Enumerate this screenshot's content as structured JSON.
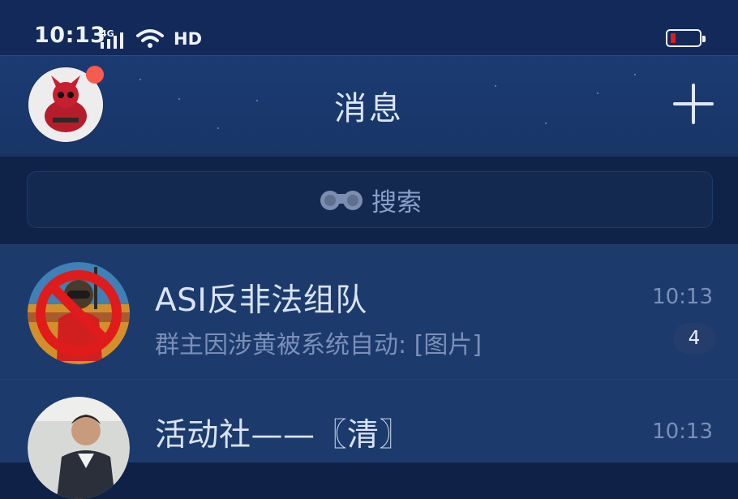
{
  "status": {
    "time": "10:13",
    "network": "4G",
    "hd": "HD"
  },
  "header": {
    "title": "消息"
  },
  "search": {
    "placeholder": "搜索"
  },
  "conversations": [
    {
      "name": "ASI反非法组队",
      "preview": "群主因涉黄被系统自动: [图片]",
      "time": "10:13",
      "unread": "4"
    },
    {
      "name": "活动社——〖清〗",
      "time": "10:13"
    }
  ],
  "colors": {
    "background": "#0f2147",
    "header": "#1b3b73",
    "accent_red": "#f75a4f",
    "battery_low": "#e31b1b"
  }
}
